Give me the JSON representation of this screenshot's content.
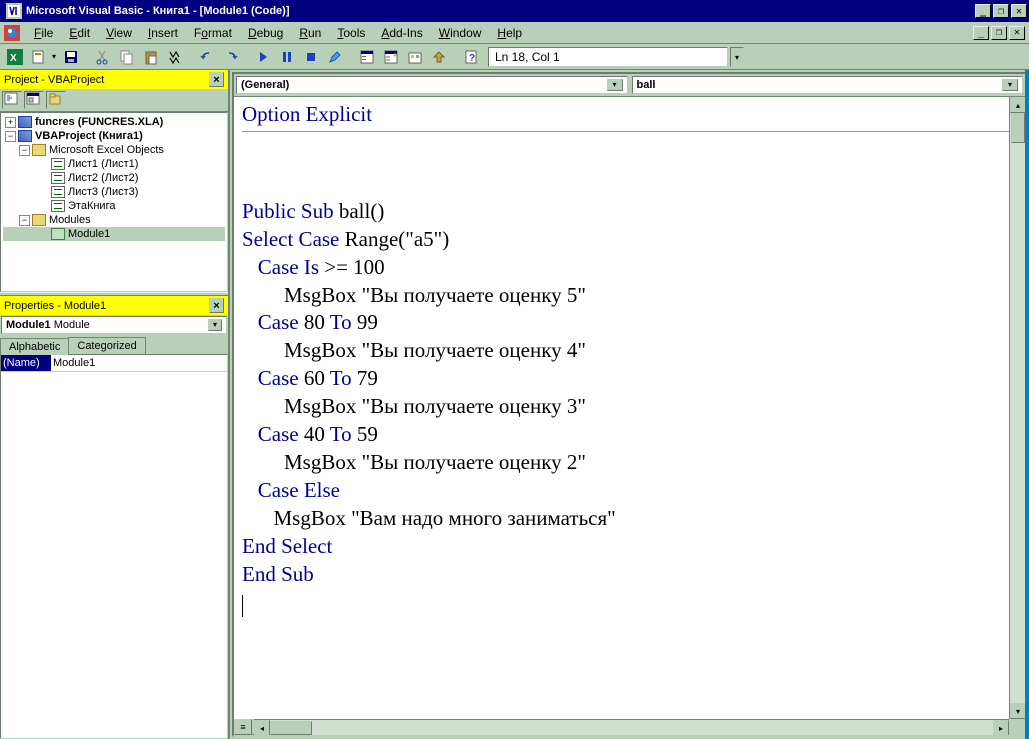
{
  "titlebar": {
    "title": "Microsoft Visual Basic - Книга1 - [Module1 (Code)]"
  },
  "menu": {
    "items": [
      "File",
      "Edit",
      "View",
      "Insert",
      "Format",
      "Debug",
      "Run",
      "Tools",
      "Add-Ins",
      "Window",
      "Help"
    ]
  },
  "toolbar": {
    "status": "Ln 18, Col 1"
  },
  "project_panel": {
    "title": "Project - VBAProject",
    "tree": {
      "root1": "funcres (FUNCRES.XLA)",
      "root2": "VBAProject (Книга1)",
      "folder_objects": "Microsoft Excel Objects",
      "sheet1": "Лист1 (Лист1)",
      "sheet2": "Лист2 (Лист2)",
      "sheet3": "Лист3 (Лист3)",
      "workbook": "ЭтаКнига",
      "folder_modules": "Modules",
      "module1": "Module1"
    }
  },
  "properties_panel": {
    "title": "Properties - Module1",
    "combo_name": "Module1",
    "combo_type": "Module",
    "tabs": {
      "alphabetic": "Alphabetic",
      "categorized": "Categorized"
    },
    "row_key": "(Name)",
    "row_val": "Module1"
  },
  "code": {
    "object_combo": "(General)",
    "proc_combo": "ball",
    "lines": {
      "l0": "Option Explicit",
      "l1_a": "Public Sub ",
      "l1_b": "ball()",
      "l2_a": "Select Case ",
      "l2_b": "Range(\"a5\")",
      "l3_a": "   Case Is ",
      "l3_b": ">= 100",
      "l4": "        MsgBox \"Вы получаете оценку 5\"",
      "l5_a": "   Case ",
      "l5_b": "80 ",
      "l5_c": "To ",
      "l5_d": "99",
      "l6": "        MsgBox \"Вы получаете оценку 4\"",
      "l7_a": "   Case ",
      "l7_b": "60 ",
      "l7_c": "To ",
      "l7_d": "79",
      "l8": "        MsgBox \"Вы получаете оценку 3\"",
      "l9_a": "   Case ",
      "l9_b": "40 ",
      "l9_c": "To ",
      "l9_d": "59",
      "l10": "        MsgBox \"Вы получаете оценку 2\"",
      "l11": "   Case Else",
      "l12": "      MsgBox \"Вам надо много заниматься\"",
      "l13": "End Select",
      "l14": "End Sub"
    }
  }
}
